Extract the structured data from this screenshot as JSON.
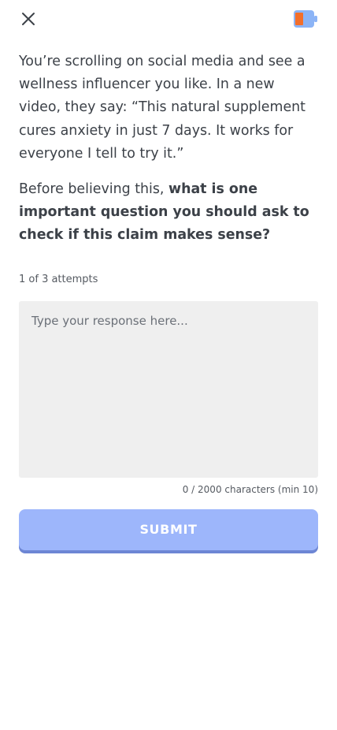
{
  "topbar": {
    "close_icon": "close-icon",
    "status_icon": "battery-icon",
    "status_colors": {
      "fill": "#f36f2b",
      "body": "#8cb4f6"
    }
  },
  "prompt": {
    "scenario": "You’re scrolling on social media and see a wellness influencer you like. In a new video, they say: “This natural supplement cures anxiety in just 7 days. It works for everyone I tell to try it.”",
    "question_lead": "Before believing this, ",
    "question_bold": "what is one important question you should ask to check if this claim makes sense?"
  },
  "attempts": "1 of 3 attempts",
  "response": {
    "value": "",
    "placeholder": "Type your response here..."
  },
  "char_count": "0 / 2000 characters (min 10)",
  "submit_label": "SUBMIT",
  "colors": {
    "text": "#3c4148",
    "input_bg": "#efefef",
    "submit_bg": "#9db6fb",
    "submit_shadow": "#6d86d4"
  }
}
